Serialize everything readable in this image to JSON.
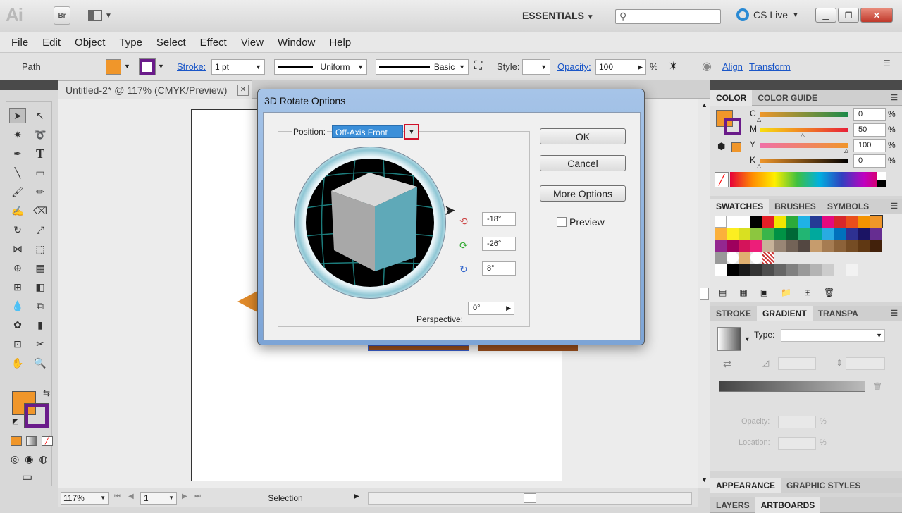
{
  "app": {
    "logo": "Ai",
    "bridge": "Br",
    "workspace": "ESSENTIALS",
    "cslive": "CS Live"
  },
  "menu": [
    "File",
    "Edit",
    "Object",
    "Type",
    "Select",
    "Effect",
    "View",
    "Window",
    "Help"
  ],
  "control": {
    "selection_label": "Path",
    "fill_color": "#f0962a",
    "stroke_color": "#6a1b8a",
    "stroke_label": "Stroke:",
    "stroke_weight": "1 pt",
    "profile": "Uniform",
    "brush": "Basic",
    "style_label": "Style:",
    "opacity_label": "Opacity:",
    "opacity_value": "100",
    "opacity_unit": "%",
    "align_label": "Align",
    "transform_label": "Transform"
  },
  "document": {
    "tab_title": "Untitled-2* @ 117% (CMYK/Preview)",
    "close": "✕"
  },
  "status": {
    "zoom": "117%",
    "page": "1",
    "mode": "Selection"
  },
  "color_panel": {
    "tabs": [
      "COLOR",
      "COLOR GUIDE"
    ],
    "channels": [
      {
        "label": "C",
        "value": "0",
        "fraction": 0.0
      },
      {
        "label": "M",
        "value": "50",
        "fraction": 0.5
      },
      {
        "label": "Y",
        "value": "100",
        "fraction": 1.0
      },
      {
        "label": "K",
        "value": "0",
        "fraction": 0.0
      }
    ],
    "percent": "%"
  },
  "swatches_panel": {
    "tabs": [
      "SWATCHES",
      "BRUSHES",
      "SYMBOLS"
    ]
  },
  "gradient_panel": {
    "tabs": [
      "STROKE",
      "GRADIENT",
      "TRANSPA"
    ],
    "type_label": "Type:",
    "opacity_label": "Opacity:",
    "location_label": "Location:",
    "percent": "%"
  },
  "bottom_panels": [
    {
      "tabs": [
        "APPEARANCE",
        "GRAPHIC STYLES"
      ]
    },
    {
      "tabs": [
        "LAYERS",
        "ARTBOARDS"
      ]
    }
  ],
  "dialog": {
    "title": "3D Rotate Options",
    "position_label": "Position:",
    "position_value": "Off-Axis Front",
    "x_angle": "-18°",
    "y_angle": "-26°",
    "z_angle": "8°",
    "perspective_label": "Perspective:",
    "perspective_value": "0°",
    "ok": "OK",
    "cancel": "Cancel",
    "more_options": "More Options",
    "preview": "Preview"
  }
}
